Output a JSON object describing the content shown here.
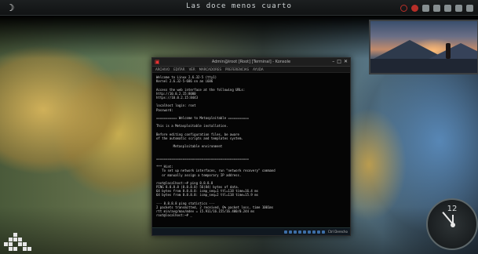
{
  "top_panel": {
    "clock_text": "Las doce menos cuarto"
  },
  "terminal": {
    "title": "Admin@iroot [Root] [Terminal] - Konsole",
    "menu": [
      "Archivo",
      "Editar",
      "Ver",
      "Marcadores",
      "Preferencias",
      "Ayuda"
    ],
    "lines": [
      "Welcome to Linux 2.6.32-5 (tty1)",
      "Kernel 2.6.32-5-686 on an i686",
      "",
      "Access the web interface at the following URLs:",
      "http://10.0.2.15:8000",
      "https://10.0.2.15:8443",
      "",
      "localhost login: root",
      "Password:",
      "",
      "=========== Welcome to Metasploitable ===========",
      "",
      "This is a Metasploitable installation.",
      "",
      "Before editing configuration files, be aware",
      "of the automatic scripts and templates system.",
      "",
      "         Metasploitable environment",
      "",
      "",
      "=================================================",
      "",
      "*** Hint:",
      "   To set up network interfaces, run \"network recovery\" command",
      "   or manually assign a temporary IP address.",
      "",
      "root@localhost:~# ping 8.8.8.8",
      "PING 8.8.8.8 (8.8.8.8) 56(84) bytes of data.",
      "64 bytes from 8.8.8.8: icmp_seq=1 ttl=118 time=16.4 ms",
      "64 bytes from 8.8.8.8: icmp_seq=2 ttl=118 time=15.9 ms",
      "",
      "--- 8.8.8.8 ping statistics ---",
      "2 packets transmitted, 2 received, 0% packet loss, time 1001ms",
      "rtt min/avg/max/mdev = 15.911/16.155/16.400/0.244 ms",
      "root@localhost:~# _"
    ],
    "status_text": "Ctrl Derecho"
  },
  "clock_widget": {
    "numeral": "12"
  }
}
